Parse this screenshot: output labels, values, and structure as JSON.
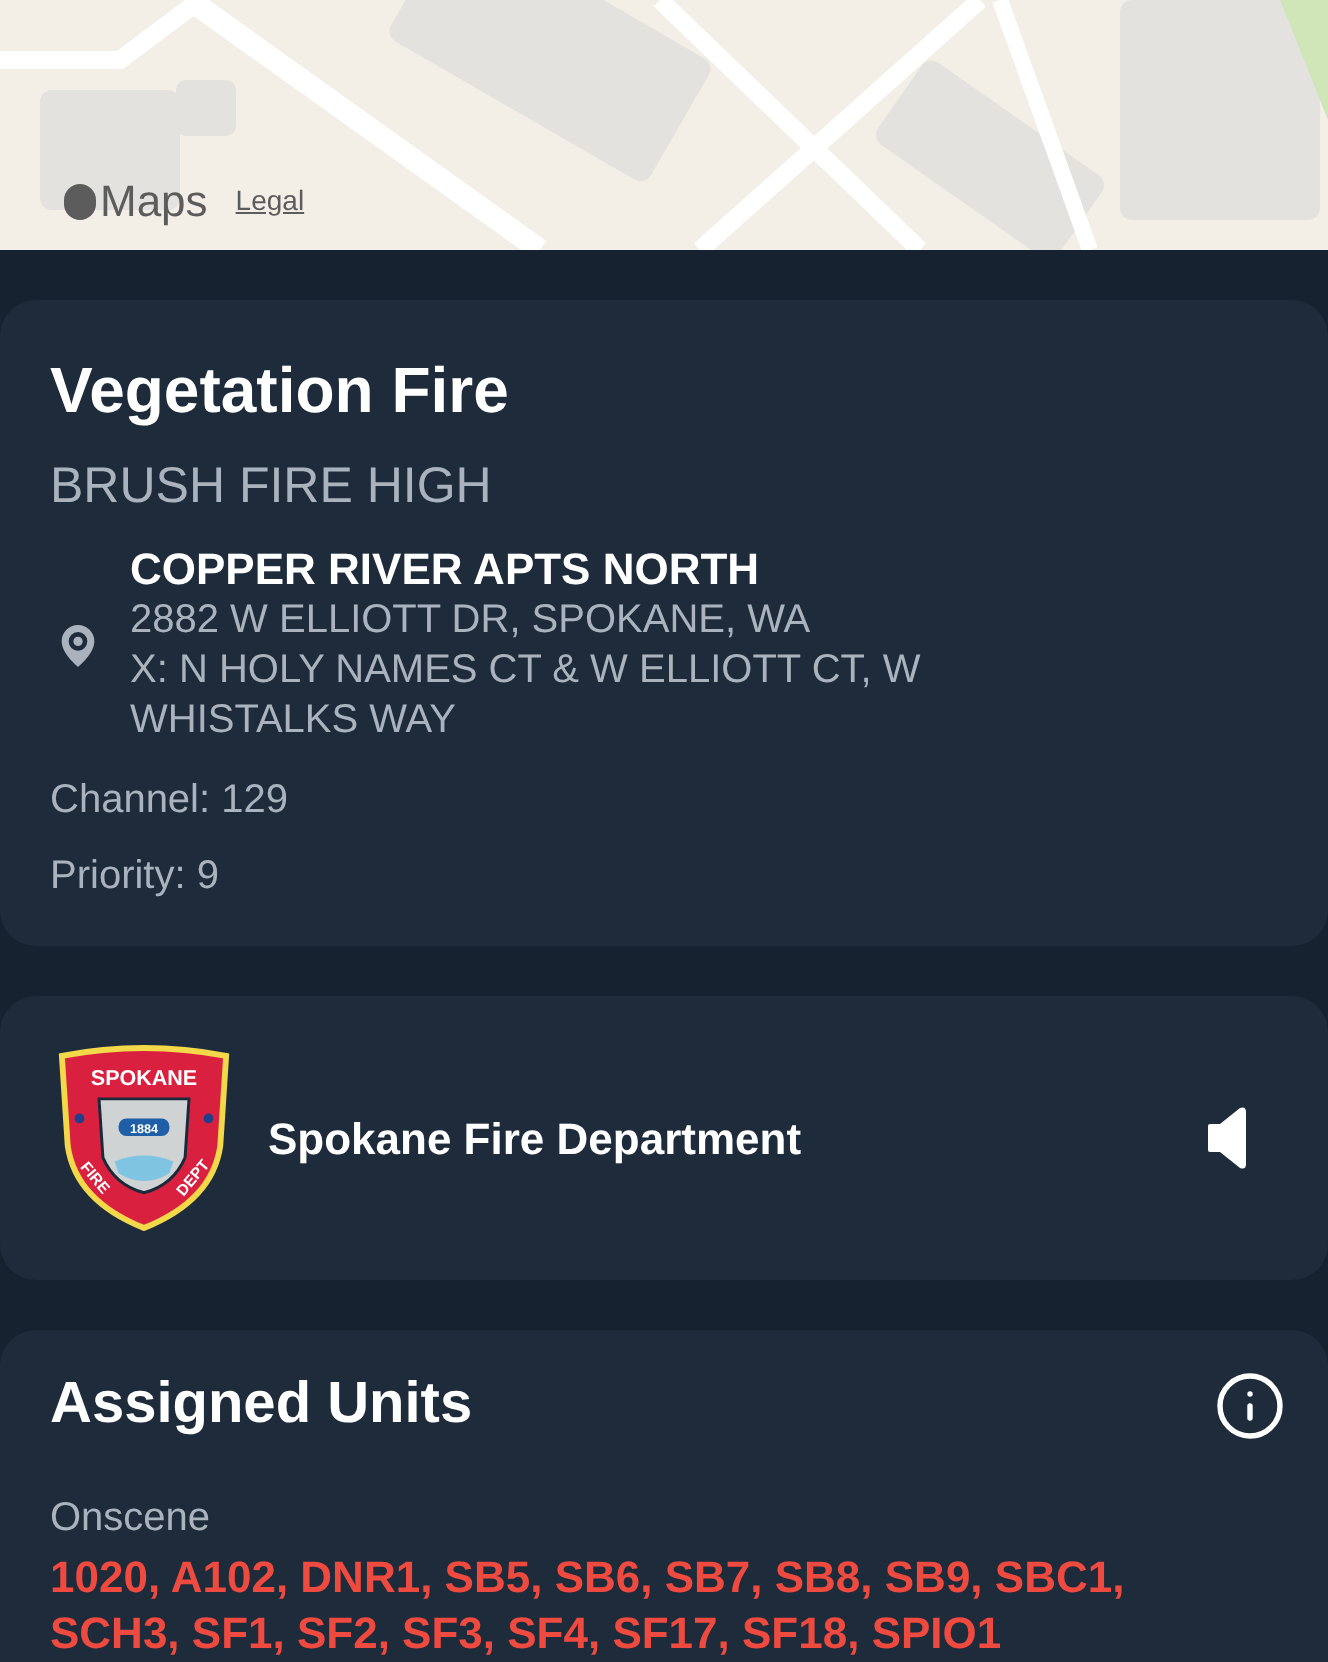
{
  "map": {
    "attribution_logo": "Maps",
    "legal_link": "Legal"
  },
  "incident": {
    "title": "Vegetation Fire",
    "subtitle": "BRUSH FIRE HIGH",
    "location_name": "COPPER RIVER APTS NORTH",
    "address": "2882 W ELLIOTT DR, SPOKANE, WA",
    "cross_streets": "X: N HOLY NAMES CT & W ELLIOTT CT, W WHISTALKS WAY",
    "channel": "Channel: 129",
    "priority": "Priority: 9"
  },
  "agency": {
    "name": "Spokane Fire Department",
    "badge_texts": [
      "SPOKANE",
      "1884",
      "FIRE",
      "DEPT"
    ],
    "muted": false
  },
  "assigned_units": {
    "title": "Assigned Units",
    "groups": [
      {
        "label": "Onscene",
        "units": "1020, A102, DNR1, SB5, SB6, SB7, SB8, SB9, SBC1, SCH3, SF1, SF2, SF3, SF4, SF17, SF18, SPIO1"
      }
    ]
  }
}
